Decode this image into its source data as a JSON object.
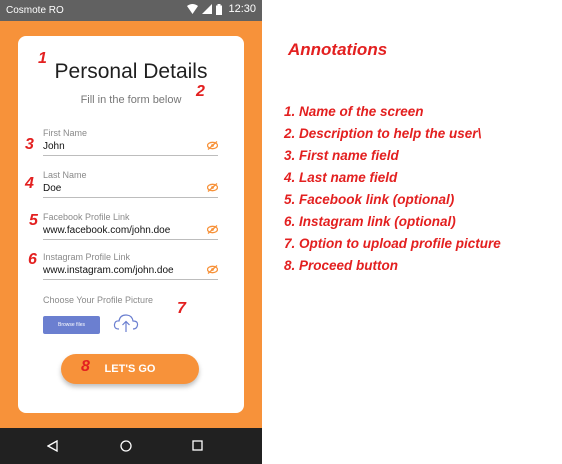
{
  "status_bar": {
    "carrier": "Cosmote RO",
    "time": "12:30"
  },
  "form": {
    "title": "Personal Details",
    "subtitle": "Fill in the form below",
    "fields": [
      {
        "label": "First Name",
        "value": "John"
      },
      {
        "label": "Last Name",
        "value": "Doe"
      },
      {
        "label": "Facebook Profile Link",
        "value": "www.facebook.com/john.doe"
      },
      {
        "label": "Instagram Profile Link",
        "value": "www.instagram.com/john.doe"
      }
    ],
    "picture_label": "Choose Your Profile Picture",
    "browse_label": "Browse files",
    "go_label": "LET'S GO"
  },
  "markers": [
    "1",
    "2",
    "3",
    "4",
    "5",
    "6",
    "7",
    "8"
  ],
  "annotations": {
    "title": "Annotations",
    "items": [
      "1. Name of the screen",
      "2. Description to help the user\\",
      "3. First name field",
      "4. Last name field",
      "5. Facebook link (optional)",
      "6. Instagram link (optional)",
      "7. Option to upload profile picture",
      "8. Proceed button"
    ]
  },
  "colors": {
    "accent": "#f7923a",
    "annotation": "#e32020",
    "browse": "#6b7fd0"
  }
}
